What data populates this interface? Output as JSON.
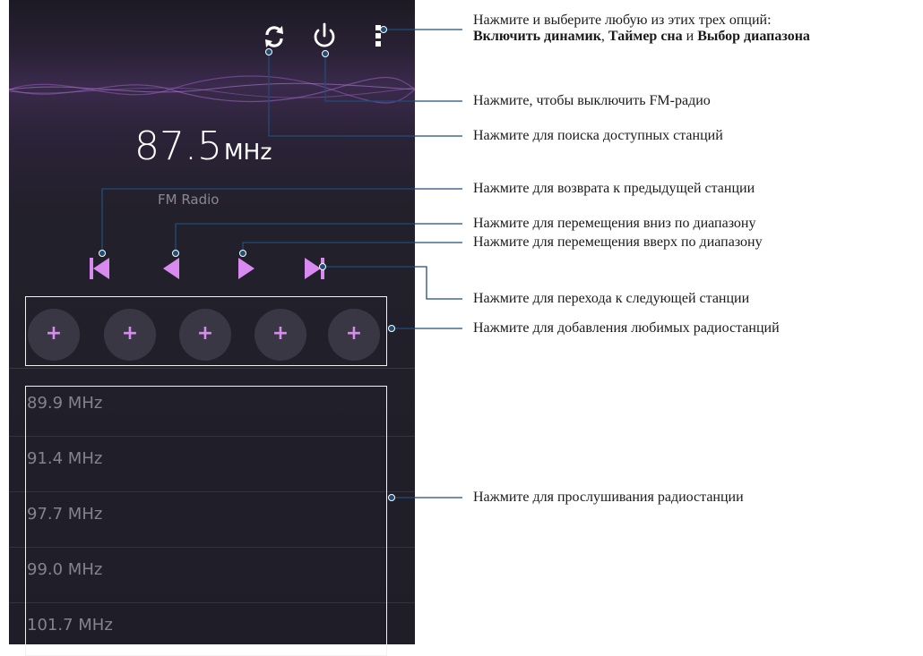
{
  "radio": {
    "frequency": "87.5",
    "unit": "MHz",
    "band_label": "FM Radio"
  },
  "top_icons": {
    "scan": "refresh-icon",
    "power": "power-icon",
    "menu": "more-vert-icon"
  },
  "controls": [
    "previous-station",
    "tune-down",
    "tune-up",
    "next-station"
  ],
  "favorites": [
    "+",
    "+",
    "+",
    "+",
    "+"
  ],
  "stations": [
    "89.9 MHz",
    "91.4 MHz",
    "97.7 MHz",
    "99.0 MHz",
    "101.7 MHz"
  ],
  "annotations": {
    "menu_line1": "Нажмите и выберите любую из этих трех опций:",
    "menu_opt1": "Включить динамик",
    "menu_comma": ",",
    "menu_opt2": "Таймер сна",
    "menu_and": "и",
    "menu_opt3": "Выбор диапазона",
    "power": "Нажмите, чтобы выключить FM-радио",
    "scan": "Нажмите для поиска доступных станций",
    "prev_station": "Нажмите для возврата к предыдущей станции",
    "tune_down": "Нажмите для перемещения вниз по диапазону",
    "tune_up": "Нажмите для перемещения вверх по диапазону",
    "next_station": "Нажмите для перехода к следующей станции",
    "favorites": "Нажмите для добавления любимых радиостанций",
    "stations": "Нажмите для прослушивания радиостанции"
  },
  "colors": {
    "accent": "#d98af0",
    "background": "#1f1e28",
    "text_dim": "#85828e",
    "callout_line": "#1f4e79"
  }
}
